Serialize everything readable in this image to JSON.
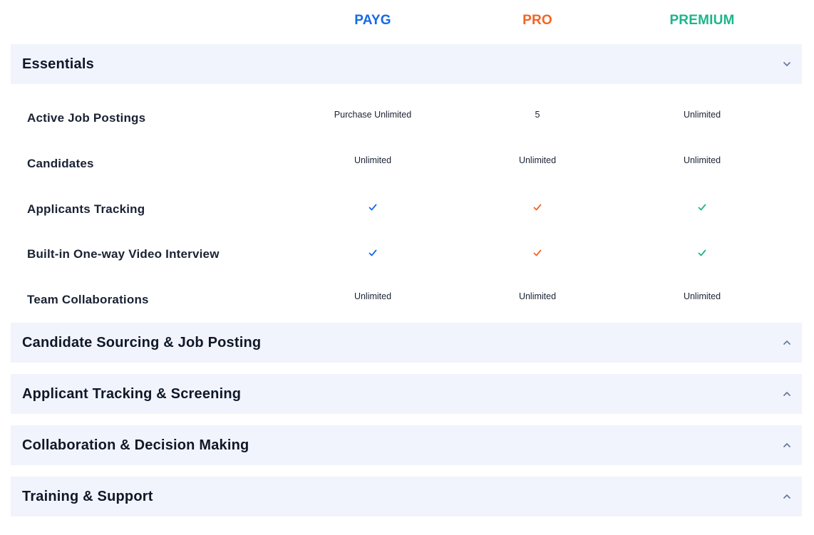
{
  "plans": [
    {
      "name": "PAYG",
      "color": "#1769e8"
    },
    {
      "name": "PRO",
      "color": "#f26522"
    },
    {
      "name": "PREMIUM",
      "color": "#1db58a"
    }
  ],
  "sections": {
    "essentials": {
      "title": "Essentials",
      "expanded": true
    },
    "sourcing": {
      "title": "Candidate Sourcing & Job Posting",
      "expanded": false
    },
    "tracking": {
      "title": "Applicant Tracking & Screening",
      "expanded": false
    },
    "collab": {
      "title": "Collaboration & Decision Making",
      "expanded": false
    },
    "training": {
      "title": "Training & Support",
      "expanded": false
    }
  },
  "features": [
    {
      "name": "Active Job Postings",
      "payg": "Purchase Unlimited",
      "pro": "5",
      "premium": "Unlimited"
    },
    {
      "name": "Candidates",
      "payg": "Unlimited",
      "pro": "Unlimited",
      "premium": "Unlimited"
    },
    {
      "name": "Applicants Tracking",
      "payg": "check-icon",
      "pro": "check-icon",
      "premium": "check-icon"
    },
    {
      "name": "Built-in One-way Video Interview",
      "payg": "check-icon",
      "pro": "check-icon",
      "premium": "check-icon"
    },
    {
      "name": "Team Collaborations",
      "payg": "Unlimited",
      "pro": "Unlimited",
      "premium": "Unlimited"
    }
  ],
  "icons": {
    "collapse": "chevron-down-icon",
    "expand": "chevron-up-icon"
  }
}
